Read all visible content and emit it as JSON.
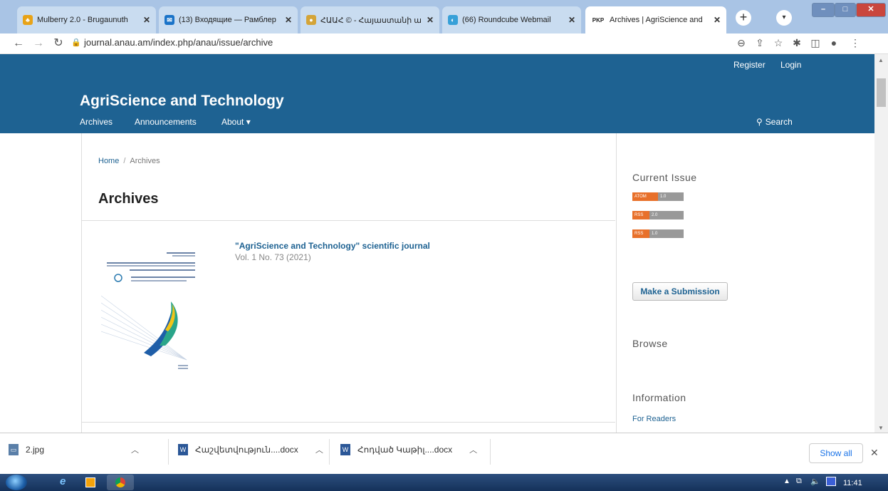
{
  "browser": {
    "tabs": [
      {
        "title": "Mulberry 2.0 - Brugaunuth",
        "fav_color": "#e8a317",
        "fav_glyph": "♣"
      },
      {
        "title": "(13) Входящие — Рамблер",
        "fav_color": "#1a73c8",
        "fav_glyph": "✉"
      },
      {
        "title": "ՀԱԱՀ © - Հայաստանի ա",
        "fav_color": "#d4a437",
        "fav_glyph": "●"
      },
      {
        "title": "(66) Roundcube Webmail",
        "fav_color": "#37a0d8",
        "fav_glyph": "◐"
      },
      {
        "title": "Archives | AgriScience and",
        "fav_color": "#222222",
        "fav_glyph": "PKP",
        "active": true
      }
    ],
    "url": "journal.anau.am/index.php/anau/issue/archive"
  },
  "site": {
    "title": "AgriScience and Technology",
    "nav": [
      "Archives",
      "Announcements",
      "About ▾"
    ],
    "register": "Register",
    "login": "Login",
    "search": "Search",
    "header_color": "#1e6292"
  },
  "main": {
    "breadcrumb_home": "Home",
    "breadcrumb_sep": "/",
    "breadcrumb_current": "Archives",
    "heading": "Archives",
    "issue": {
      "title": "\"AgriScience and Technology\" scientific journal",
      "series": "Vol. 1 No. 73 (2021)"
    }
  },
  "sidebar": {
    "current_issue": "Current Issue",
    "feeds": [
      {
        "left": "ATOM",
        "right": "1.0"
      },
      {
        "left": "RSS",
        "right": "2.0"
      },
      {
        "left": "RSS",
        "right": "1.0"
      }
    ],
    "submit": "Make a Submission",
    "browse": "Browse",
    "information": "Information",
    "for_readers": "For Readers"
  },
  "downloads": {
    "items": [
      "2.jpg",
      "Հաշվետվություն....docx",
      "Հոդված Կաթիլ....docx"
    ],
    "show_all": "Show all"
  },
  "taskbar": {
    "time": "11:41"
  }
}
